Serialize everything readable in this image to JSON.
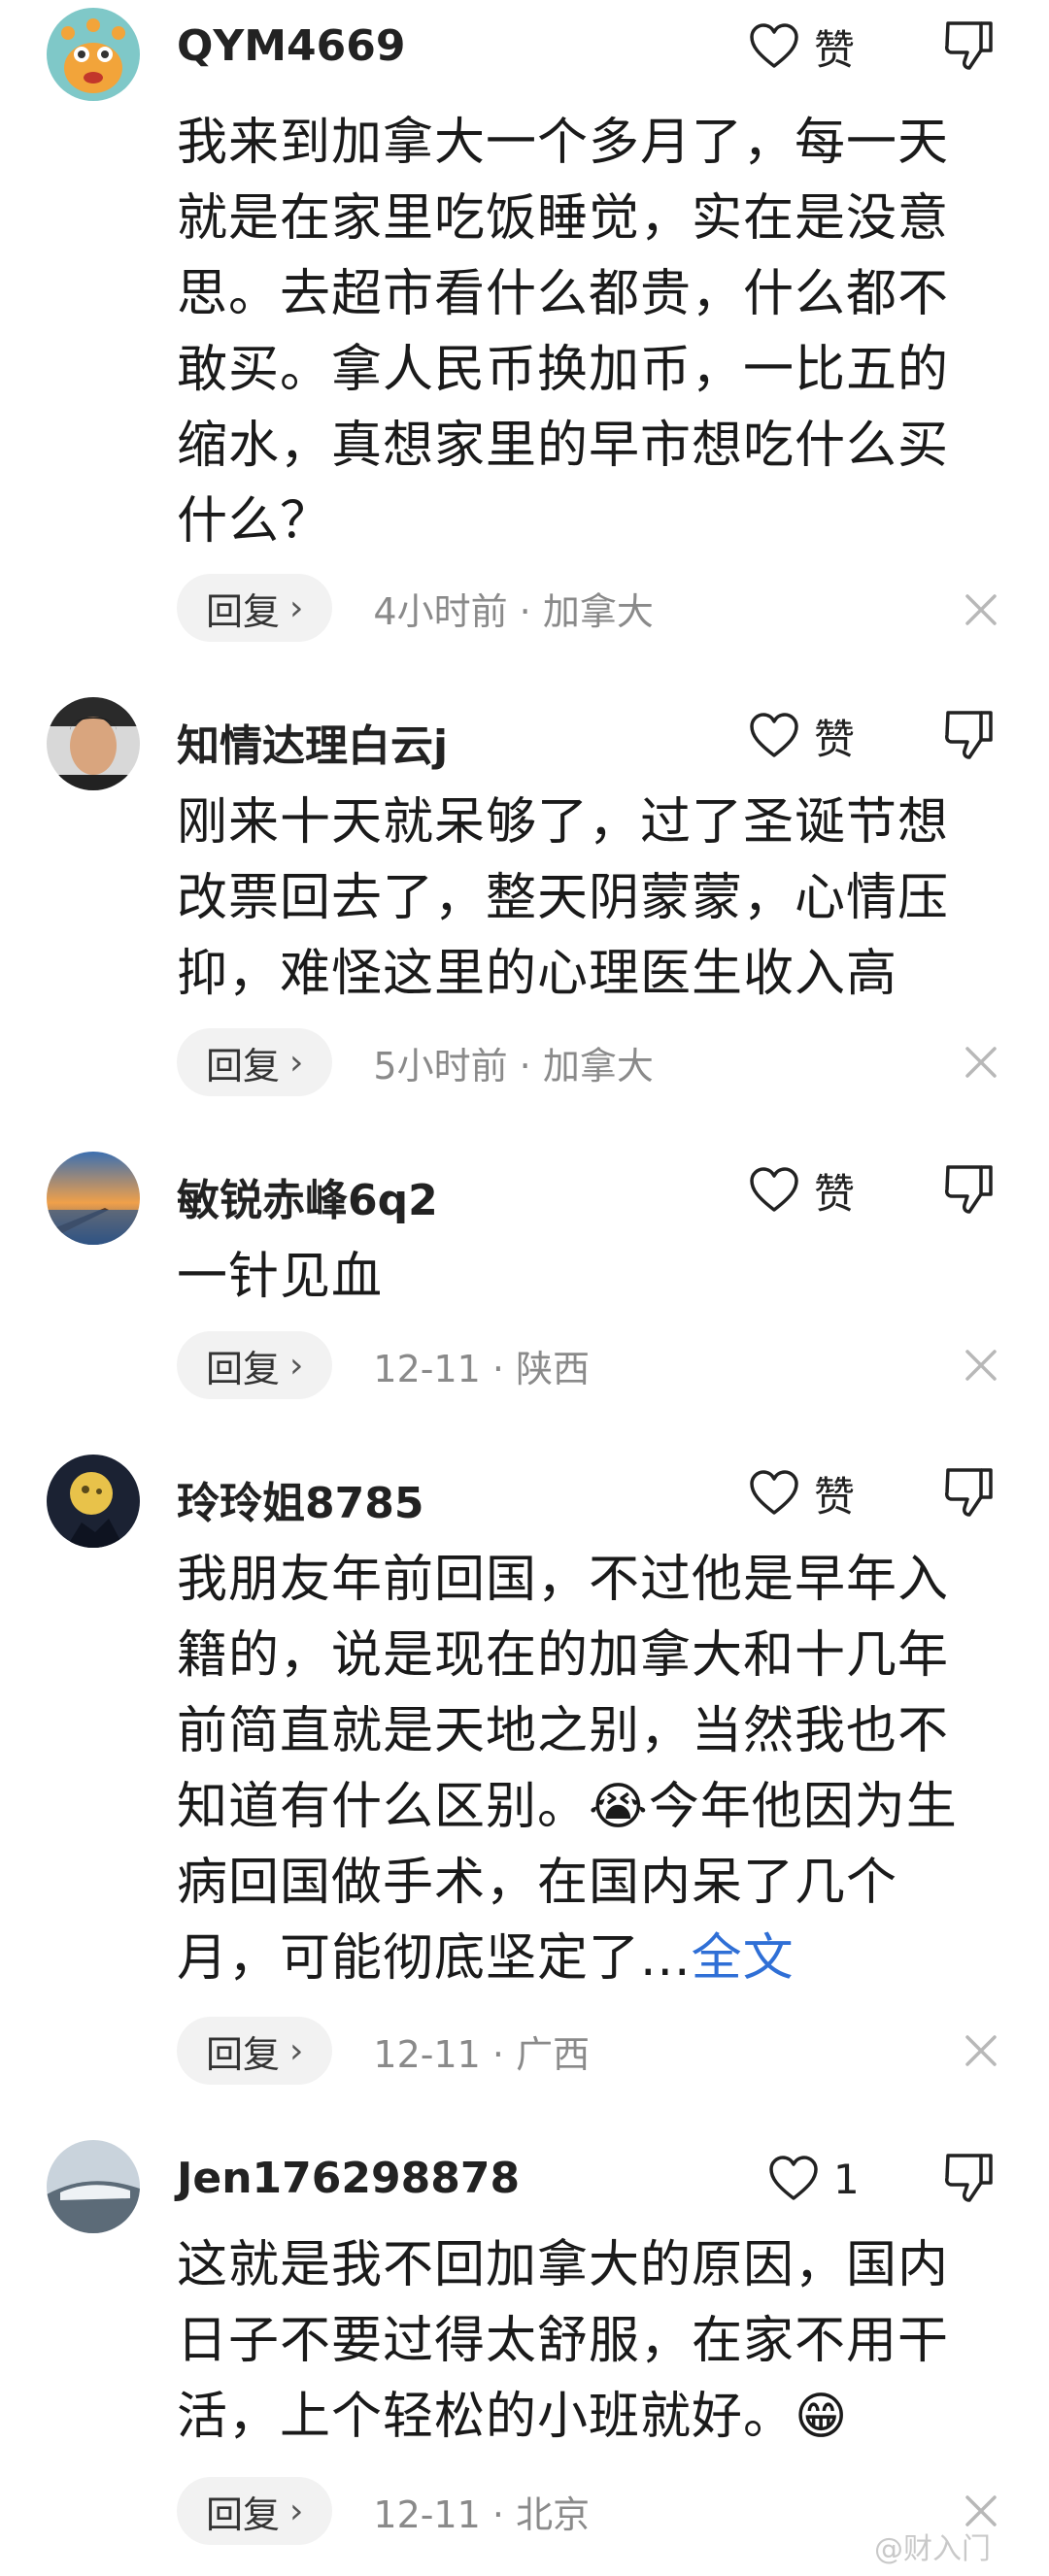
{
  "like_label": "赞",
  "reply_label": "回复",
  "comments": [
    {
      "username": "QYM4669",
      "lines": [
        "我来到加拿大一个多月了，每一天",
        "就是在家里吃饭睡觉，实在是没意",
        "思。去超市看什么都贵，什么都不",
        "敢买。拿人民币换加币，一比五的",
        "缩水，真想家里的早市想吃什么买",
        "什么？"
      ],
      "meta": "4小时前 · 加拿大",
      "like_text": "赞"
    },
    {
      "username": "知情达理白云j",
      "lines": [
        "刚来十天就呆够了，过了圣诞节想",
        "改票回去了，整天阴蒙蒙，心情压",
        "抑，难怪这里的心理医生收入高"
      ],
      "meta": "5小时前 · 加拿大",
      "like_text": "赞"
    },
    {
      "username": "敏锐赤峰6q2",
      "lines": [
        "一针见血"
      ],
      "meta": "12-11 · 陕西",
      "like_text": "赞"
    },
    {
      "username": "玲玲姐8785",
      "lines": [
        "我朋友年前回国，不过他是早年入",
        "籍的，说是现在的加拿大和十几年",
        "前简直就是天地之别，当然我也不",
        "知道有什么区别。😭今年他因为生",
        "病回国做手术，在国内呆了几个",
        "月，可能彻底坚定了..."
      ],
      "full_text_link": "全文",
      "meta": "12-11 · 广西",
      "like_text": "赞"
    },
    {
      "username": "Jen176298878",
      "lines": [
        "这就是我不回加拿大的原因，国内",
        "日子不要过得太舒服，在家不用干",
        "活，上个轻松的小班就好。😁"
      ],
      "meta": "12-11 · 北京",
      "like_text": "1"
    }
  ],
  "watermark": "@财入门",
  "colors": {
    "link": "#2f6fd6",
    "meta": "#8a8a8a",
    "reply_bg": "#f2f2f2"
  }
}
